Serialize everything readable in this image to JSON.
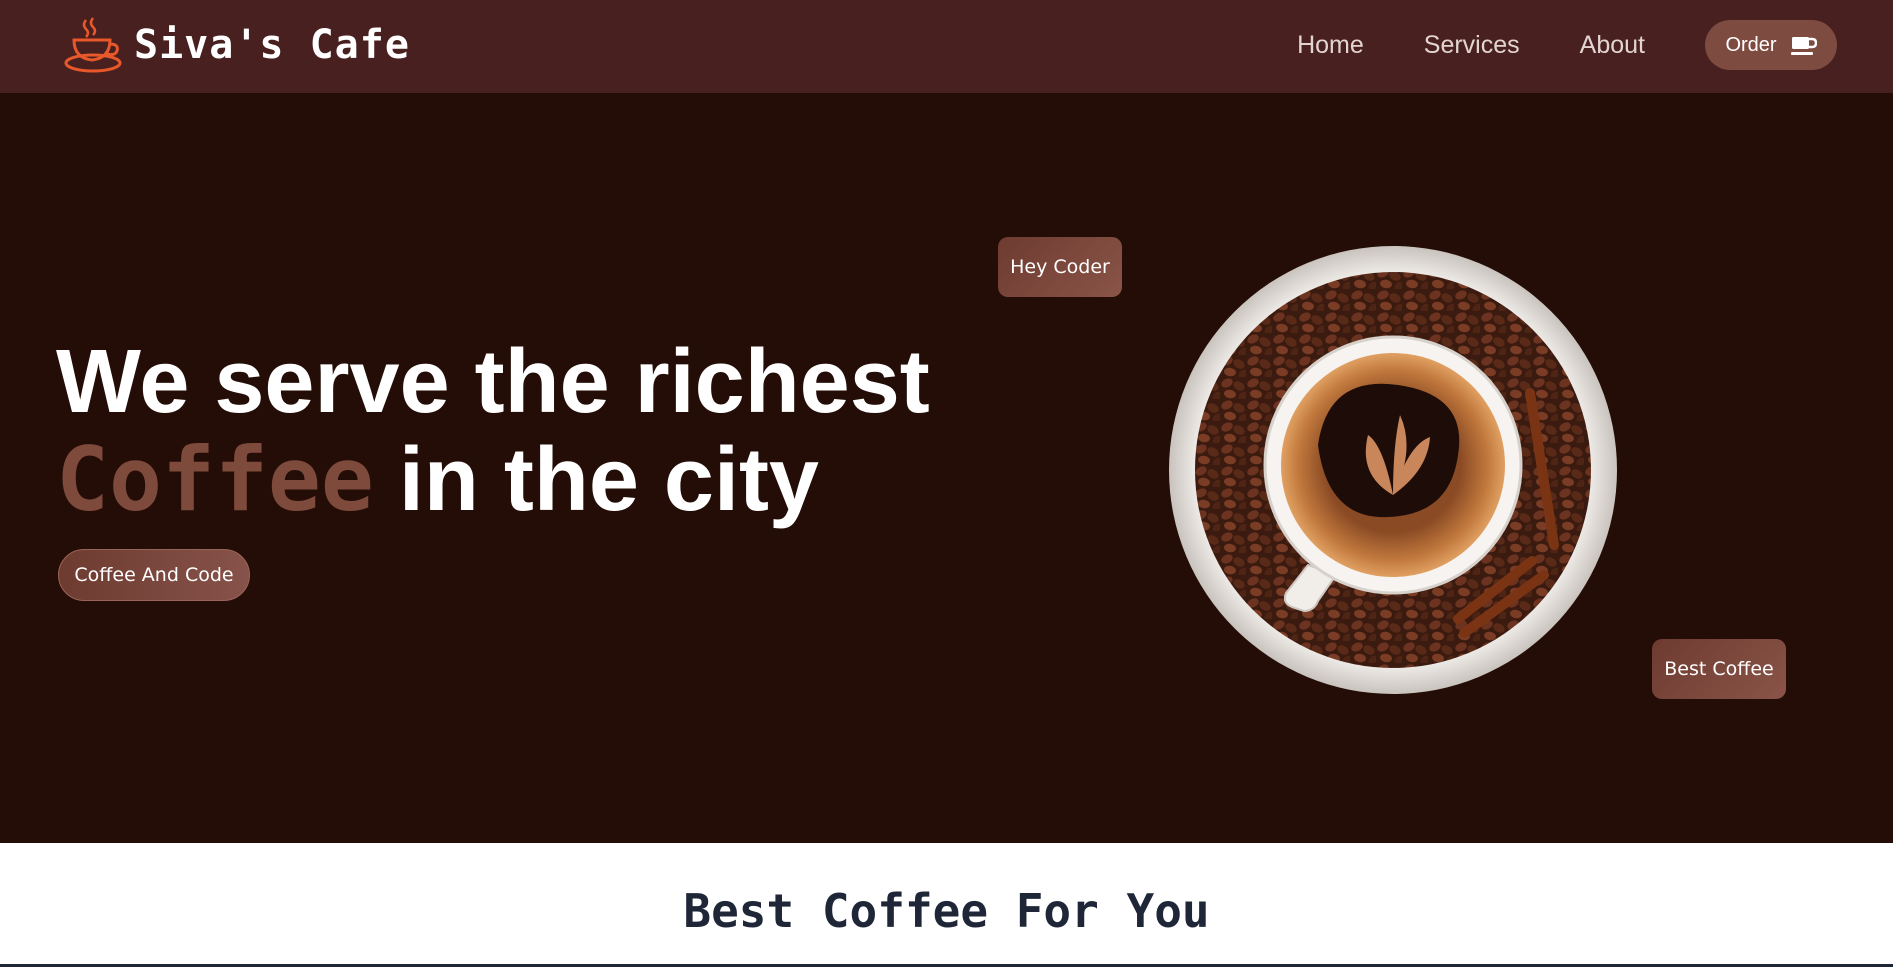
{
  "brand": {
    "name": "Siva's Cafe",
    "logo_icon": "coffee-cup-logo-icon",
    "logo_color": "#e8582a"
  },
  "nav": {
    "links": [
      "Home",
      "Services",
      "About"
    ],
    "order_label": "Order",
    "order_icon": "coffee-cup-icon"
  },
  "hero": {
    "headline_line1": "We serve the richest",
    "headline_accent": "Coffee",
    "headline_rest": " in the city",
    "cta_label": "Coffee And Code",
    "tag_top": "Hey Coder",
    "tag_bottom": "Best Coffee",
    "image_icon": "coffee-cup-with-beans-image"
  },
  "section": {
    "title": "Best Coffee For You"
  },
  "colors": {
    "navbar_bg": "#47201f",
    "hero_bg": "#240d06",
    "accent": "#7e4a3c",
    "button": "#7e4b41"
  }
}
